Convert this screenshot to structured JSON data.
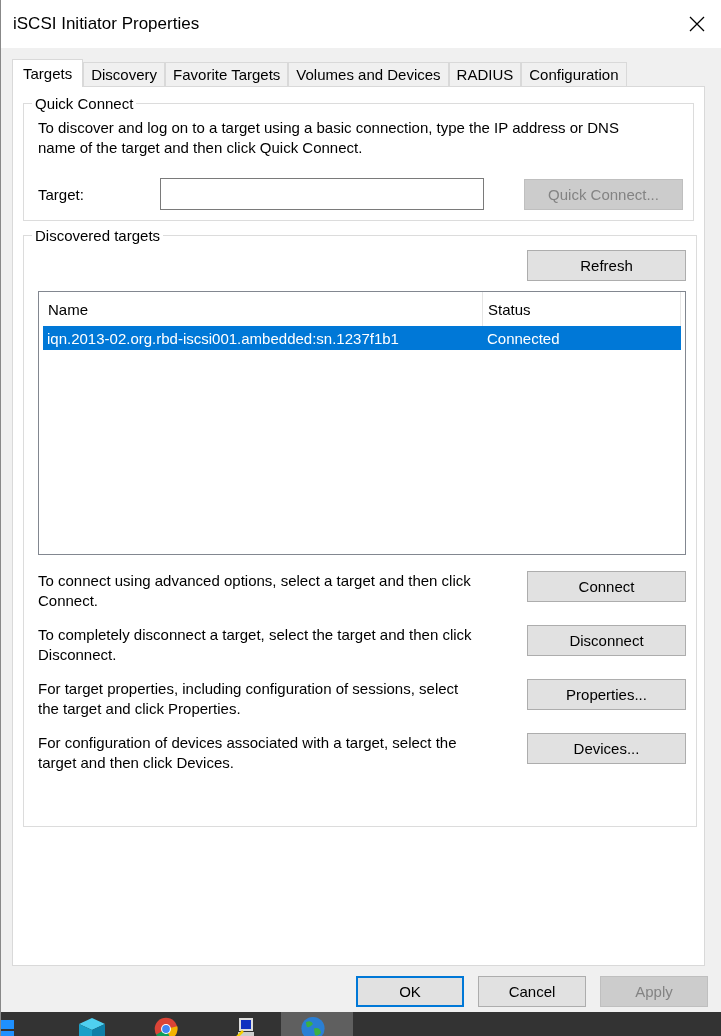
{
  "window": {
    "title": "iSCSI Initiator Properties"
  },
  "tabs": [
    {
      "label": "Targets",
      "selected": true
    },
    {
      "label": "Discovery",
      "selected": false
    },
    {
      "label": "Favorite Targets",
      "selected": false
    },
    {
      "label": "Volumes and Devices",
      "selected": false
    },
    {
      "label": "RADIUS",
      "selected": false
    },
    {
      "label": "Configuration",
      "selected": false
    }
  ],
  "quick_connect": {
    "title": "Quick Connect",
    "description": "To discover and log on to a target using a basic connection, type the IP address or DNS name of the target and then click Quick Connect.",
    "target_label": "Target:",
    "button": {
      "label": "Quick Connect...",
      "disabled": true
    }
  },
  "discovered_targets": {
    "title": "Discovered targets",
    "refresh": {
      "label": "Refresh",
      "disabled": false
    },
    "columns": [
      "Name",
      "Status"
    ],
    "rows": [
      {
        "name": "iqn.2013-02.org.rbd-iscsi001.ambedded:sn.1237f1b1",
        "status": "Connected",
        "selected": true
      }
    ],
    "actions": [
      {
        "text": "To connect using advanced options, select a target and then click Connect.",
        "button": {
          "label": "Connect",
          "disabled": false
        }
      },
      {
        "text": "To completely disconnect a target, select the target and then click Disconnect.",
        "button": {
          "label": "Disconnect",
          "disabled": false
        }
      },
      {
        "text": "For target properties, including configuration of sessions, select the target and click Properties.",
        "button": {
          "label": "Properties...",
          "disabled": false
        }
      },
      {
        "text": "For configuration of devices associated with a target, select the target and then click Devices.",
        "button": {
          "label": "Devices...",
          "disabled": false
        }
      }
    ]
  },
  "dialog_buttons": [
    {
      "label": "OK",
      "default": true,
      "disabled": false
    },
    {
      "label": "Cancel",
      "default": false,
      "disabled": false
    },
    {
      "label": "Apply",
      "default": false,
      "disabled": true
    }
  ]
}
